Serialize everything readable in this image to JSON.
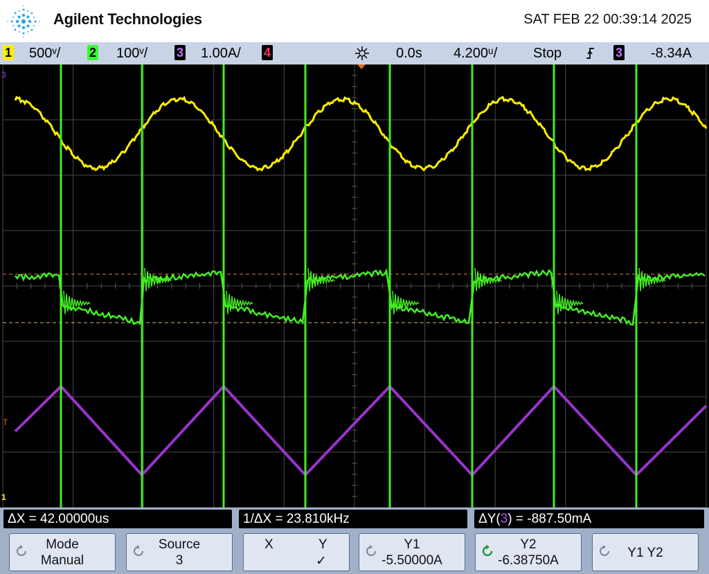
{
  "header": {
    "brand": "Agilent Technologies",
    "datetime": "SAT FEB 22 00:39:14 2025"
  },
  "status": {
    "ch1": {
      "num": "1",
      "scale": "500ᵛ/",
      "color": "#ffee00"
    },
    "ch2": {
      "num": "2",
      "scale": "100ᵛ/",
      "color": "#33ff33"
    },
    "ch3": {
      "num": "3",
      "scale": "1.00A/",
      "color": "#9933cc"
    },
    "ch4": {
      "num": "4",
      "color": "#ff3366"
    },
    "delay": "0.0s",
    "timebase": "4.200ᵘ/",
    "run_state": "Stop",
    "trigger_source": "3",
    "trigger_level": "-8.34A"
  },
  "markers": {
    "ch3_ref": "3",
    "ch1_ground": "1",
    "trigger": "T"
  },
  "measurements": {
    "dx": "ΔX = 42.00000us",
    "inv_dx": "1/ΔX = 23.810kHz",
    "dy_prefix": "ΔY(",
    "dy_channel": "3",
    "dy_suffix": ") = -887.50mA"
  },
  "softkeys": {
    "mode": {
      "title": "Mode",
      "value": "Manual"
    },
    "source": {
      "title": "Source",
      "value": "3"
    },
    "xy": {
      "x": "X",
      "y": "Y",
      "check": "✓"
    },
    "y1": {
      "title": "Y1",
      "value": "-5.50000A"
    },
    "y2": {
      "title": "Y2",
      "value": "-6.38750A"
    },
    "y1y2": {
      "label": "Y1 Y2"
    }
  }
}
